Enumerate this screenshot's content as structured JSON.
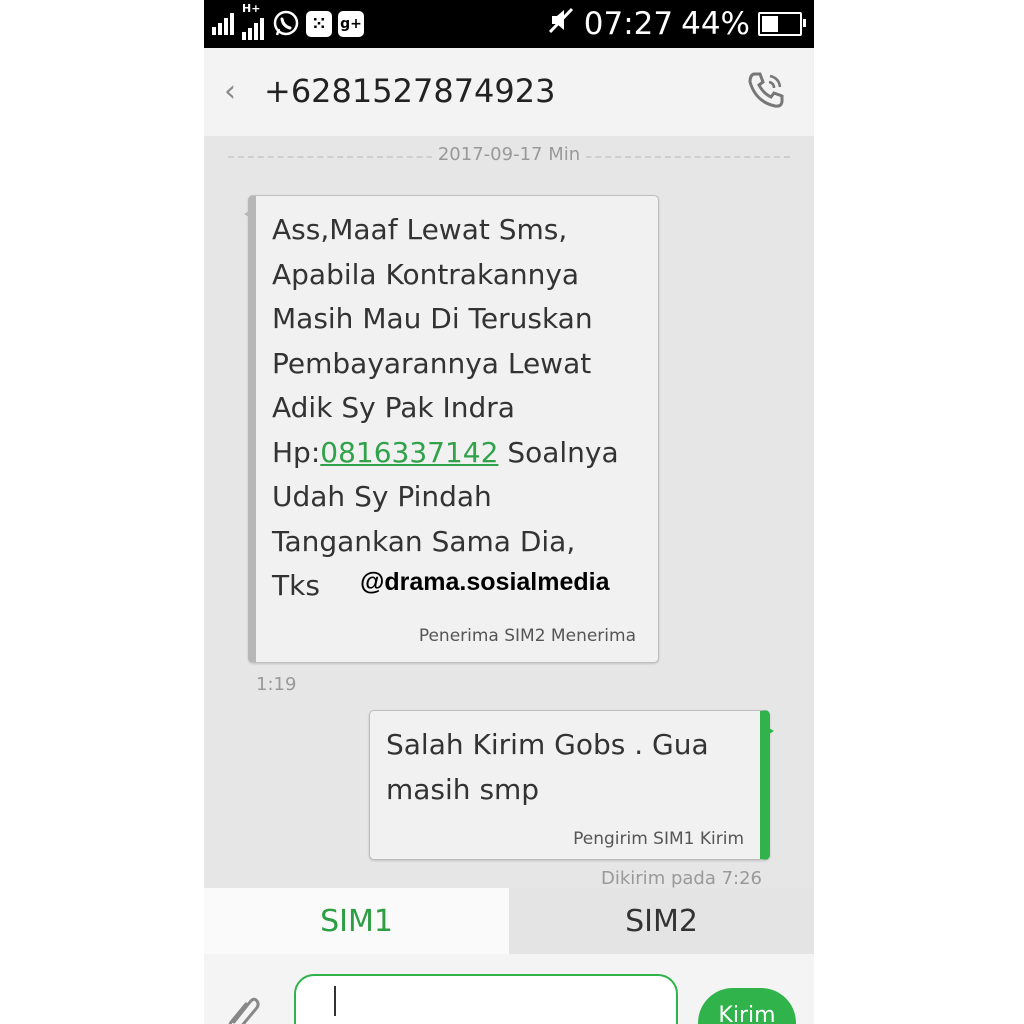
{
  "status_bar": {
    "time": "07:27",
    "battery_percent": "44%",
    "battery_level": 0.44,
    "notification_icons": [
      "signal-icon",
      "hplus-signal-icon",
      "whatsapp-icon",
      "bbm-icon",
      "google-plus-icon"
    ],
    "bbm_glyph": "⁙",
    "gplus_glyph": "g+",
    "hplus_label": "H+"
  },
  "header": {
    "back_glyph": "‹",
    "contact_number": "+6281527874923"
  },
  "conversation": {
    "date_divider": "2017-09-17 Min",
    "incoming": {
      "text_before_link": "Ass,Maaf Lewat Sms,\nApabila Kontrakannya\nMasih Mau Di Teruskan\nPembayarannya Lewat\nAdik Sy Pak Indra\nHp:",
      "link_number": "0816337142",
      "text_after_link": " Soalnya\nUdah Sy Pindah\nTangankan Sama Dia,\nTks",
      "status": "Penerima SIM2 Menerima",
      "time": "1:19"
    },
    "watermark": "@drama.sosialmedia",
    "outgoing": {
      "text": "Salah Kirim Gobs . Gua\nmasih smp",
      "status": "Pengirim SIM1 Kirim",
      "sent_info": "Dikirim pada 7:26"
    }
  },
  "sim_tabs": [
    {
      "label": "SIM1",
      "active": true
    },
    {
      "label": "SIM2",
      "active": false
    }
  ],
  "composer": {
    "send_label": "Kirim",
    "value": ""
  },
  "colors": {
    "accent_green": "#2fb34a",
    "link_green": "#2fa24a",
    "status_bar": "#000000",
    "background": "#e6e6e6"
  }
}
